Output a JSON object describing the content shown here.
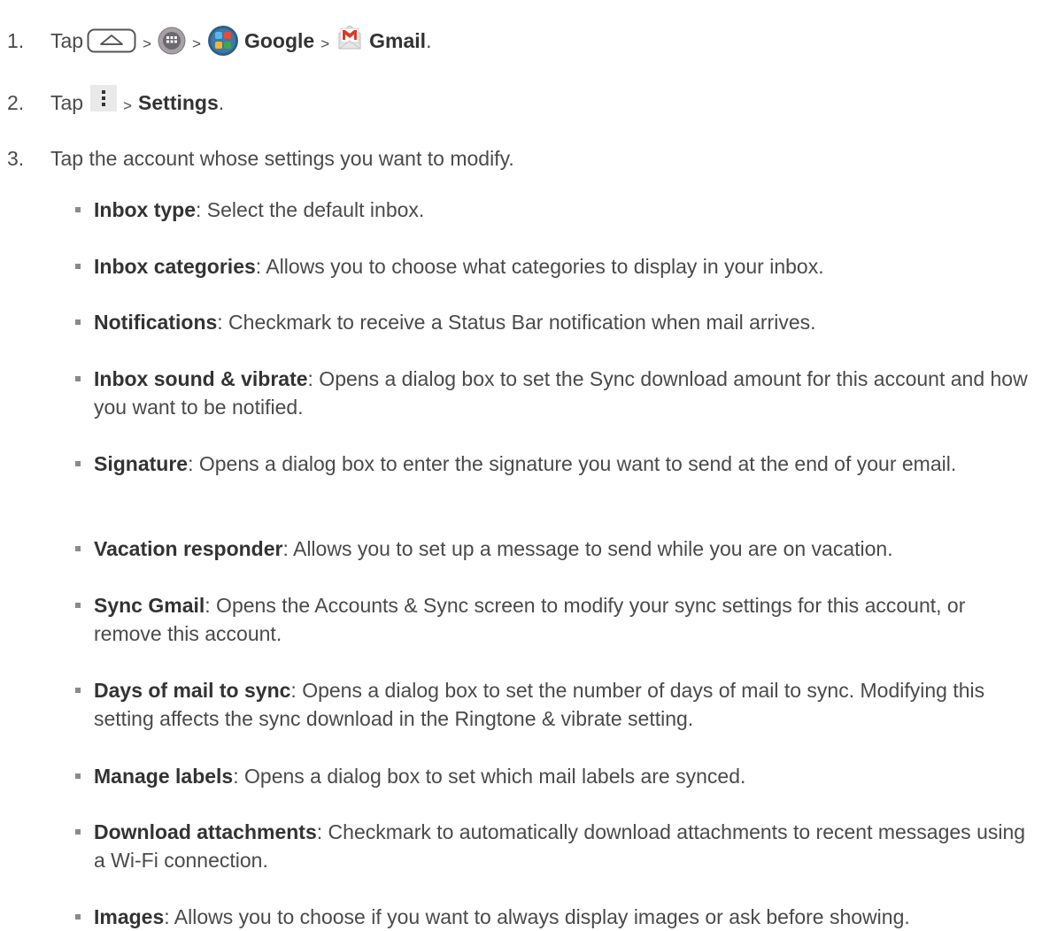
{
  "steps": [
    {
      "num": "1.",
      "tap": "Tap",
      "sep": ">",
      "google": "Google",
      "gmail": "Gmail",
      "end": "."
    },
    {
      "num": "2.",
      "tap": "Tap",
      "sep": ">",
      "settings": "Settings",
      "end": "."
    },
    {
      "num": "3.",
      "text": "Tap the account whose settings you want to modify."
    }
  ],
  "icons": [
    "home-key-icon",
    "apps-icon",
    "google-folder-icon",
    "gmail-icon",
    "menu-overflow-icon"
  ],
  "items": [
    {
      "term": "Inbox type",
      "desc": ": Select the default inbox."
    },
    {
      "term": "Inbox categories",
      "desc": ": Allows you to choose what categories to display in your inbox."
    },
    {
      "term": "Notifications",
      "desc": ": Checkmark to receive a Status Bar notification when mail arrives."
    },
    {
      "term": "Inbox sound & vibrate",
      "desc": ": Opens a dialog box to set the Sync download amount for this account and how you want to be notified."
    },
    {
      "term": "Signature",
      "desc": ": Opens a dialog box to enter the signature you want to send at the end of your email."
    },
    {
      "term": "Vacation responder",
      "desc": ": Allows you to set up a message to send while you are on vacation."
    },
    {
      "term": "Sync Gmail",
      "desc": ": Opens the Accounts & Sync screen to modify your sync settings for this account, or remove this account."
    },
    {
      "term": "Days of mail to sync",
      "desc": ": Opens a dialog box to set the number of days of mail to sync. Modifying this setting affects the sync download in the Ringtone & vibrate setting."
    },
    {
      "term": "Manage labels",
      "desc": ": Opens a dialog box to set which mail labels are synced."
    },
    {
      "term": "Download attachments",
      "desc": ": Checkmark to automatically download attachments to recent messages using a Wi-Fi connection."
    },
    {
      "term": "Images",
      "desc": ": Allows you to choose if you want to always display images or ask before showing."
    }
  ]
}
